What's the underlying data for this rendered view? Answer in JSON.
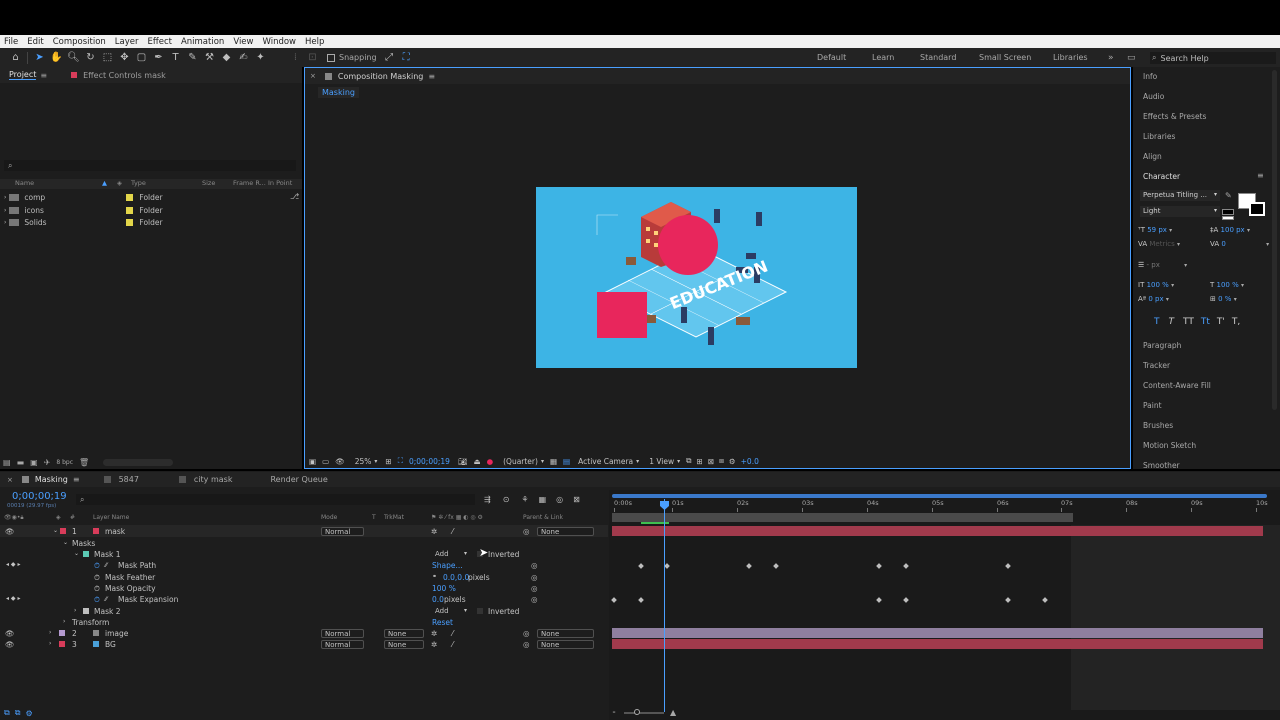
{
  "menu": [
    "File",
    "Edit",
    "Composition",
    "Layer",
    "Effect",
    "Animation",
    "View",
    "Window",
    "Help"
  ],
  "toolbar": {
    "snapping": "Snapping"
  },
  "workspaces": [
    "Default",
    "Learn",
    "Standard",
    "Small Screen",
    "Libraries"
  ],
  "search_help": "Search Help",
  "project": {
    "tab_project": "Project",
    "tab_effect": "Effect Controls mask",
    "columns": [
      "Name",
      "Type",
      "Size",
      "Frame R...",
      "In Point"
    ],
    "items": [
      {
        "name": "comp",
        "type": "Folder"
      },
      {
        "name": "icons",
        "type": "Folder"
      },
      {
        "name": "Solids",
        "type": "Folder"
      }
    ],
    "bpc": "8 bpc"
  },
  "composition": {
    "tab": "Composition Masking",
    "subtab": "Masking",
    "zoom": "25%",
    "timecode": "0;00;00;19",
    "resolution": "(Quarter)",
    "camera": "Active Camera",
    "view": "1 View",
    "exposure": "+0.0"
  },
  "canvas": {
    "bg": "#3db4e5",
    "accent": "#e8265c",
    "text": "EDUCATION"
  },
  "right_panels": [
    "Info",
    "Audio",
    "Effects & Presets",
    "Libraries",
    "Align",
    "Character"
  ],
  "right_panels2": [
    "Paragraph",
    "Tracker",
    "Content-Aware Fill",
    "Paint",
    "Brushes",
    "Motion Sketch",
    "Smoother"
  ],
  "character": {
    "font": "Perpetua Titling ...",
    "style": "Light",
    "size": "59 px",
    "leading": "Metrics",
    "kern": "100 px",
    "tracking": "0",
    "stroke": "- px",
    "vscale": "100 %",
    "hscale": "100 %",
    "baseline": "0 px",
    "tsume": "0 %",
    "styles": [
      "T",
      "T",
      "TT",
      "Tt",
      "T'",
      "T,"
    ]
  },
  "timeline": {
    "tabs": [
      "Masking",
      "5847",
      "city mask",
      "Render Queue"
    ],
    "timecode": "0;00;00;19",
    "frames": "00019 (29.97 fps)",
    "col_layer": "Layer Name",
    "col_mode": "Mode",
    "col_t": "T",
    "col_trk": "TrkMat",
    "col_parent": "Parent & Link",
    "ruler": [
      "0:00s",
      "01s",
      "02s",
      "03s",
      "04s",
      "05s",
      "06s",
      "07s",
      "08s",
      "09s",
      "10s"
    ],
    "layers": [
      {
        "num": "1",
        "name": "mask",
        "mode": "Normal",
        "parent": "None",
        "color": "#d83c5a"
      },
      {
        "label": "Masks"
      },
      {
        "label": "Mask 1",
        "add": "Add",
        "inv": "Inverted"
      },
      {
        "label": "Mask Path",
        "val": "Shape..."
      },
      {
        "label": "Mask Feather",
        "val": "0.0,0.0",
        "unit": "pixels"
      },
      {
        "label": "Mask Opacity",
        "val": "100 %"
      },
      {
        "label": "Mask Expansion",
        "val": "0.0",
        "unit": "pixels"
      },
      {
        "label": "Mask 2",
        "add": "Add",
        "inv": "Inverted"
      },
      {
        "label": "Transform",
        "val": "Reset"
      },
      {
        "num": "2",
        "name": "image",
        "mode": "Normal",
        "trk": "None",
        "parent": "None",
        "color": "#b49ad0"
      },
      {
        "num": "3",
        "name": "BG",
        "mode": "Normal",
        "trk": "None",
        "parent": "None",
        "color": "#4aa0d8"
      }
    ]
  }
}
